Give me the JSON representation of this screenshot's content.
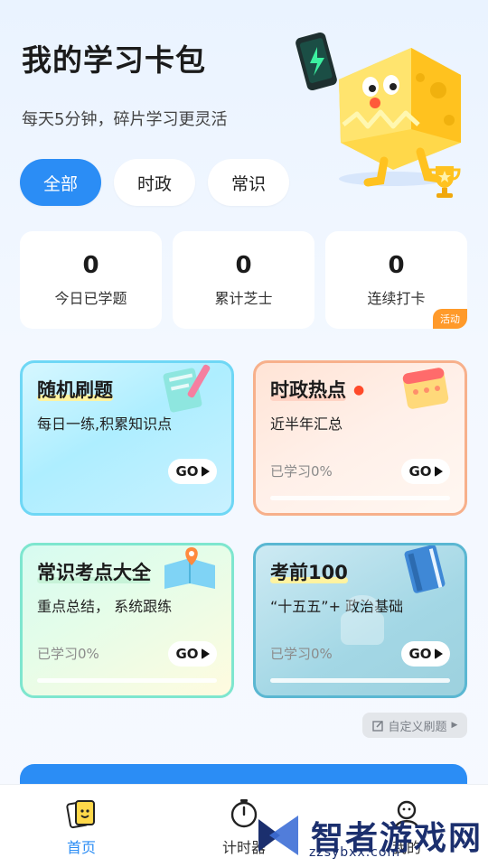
{
  "header": {
    "title": "我的学习卡包",
    "subtitle": "每天5分钟，碎片学习更灵活"
  },
  "filter_tabs": [
    {
      "label": "全部",
      "active": true
    },
    {
      "label": "时政",
      "active": false
    },
    {
      "label": "常识",
      "active": false
    }
  ],
  "stats": [
    {
      "value": "0",
      "label": "今日已学题"
    },
    {
      "value": "0",
      "label": "累计芝士"
    },
    {
      "value": "0",
      "label": "连续打卡",
      "badge": "活动"
    }
  ],
  "cards": [
    {
      "title": "随机刷题",
      "desc": "每日一练,积累知识点",
      "progress_text": "",
      "go": "GO",
      "progress": 0
    },
    {
      "title": "时政热点",
      "desc": "近半年汇总",
      "progress_text": "已学习0%",
      "go": "GO",
      "progress": 0
    },
    {
      "title": "常识考点大全",
      "desc": "重点总结， 系统跟练",
      "progress_text": "已学习0%",
      "go": "GO",
      "progress": 0
    },
    {
      "title": "考前100",
      "desc": "“十五五”+ 政治基础",
      "progress_text": "已学习0%",
      "go": "GO",
      "progress": 0,
      "locked": true
    }
  ],
  "custom_button": {
    "label": "自定义刷题"
  },
  "bottom_nav": [
    {
      "label": "首页",
      "icon": "card-home-icon",
      "active": true
    },
    {
      "label": "计时器",
      "icon": "timer-icon",
      "active": false
    },
    {
      "label": "我的",
      "icon": "profile-icon",
      "active": false
    }
  ],
  "watermark": {
    "text": "智者游戏网",
    "sub": "zzsybxx.com"
  },
  "colors": {
    "accent": "#2b8df5",
    "badge": "#ff9a2a"
  }
}
